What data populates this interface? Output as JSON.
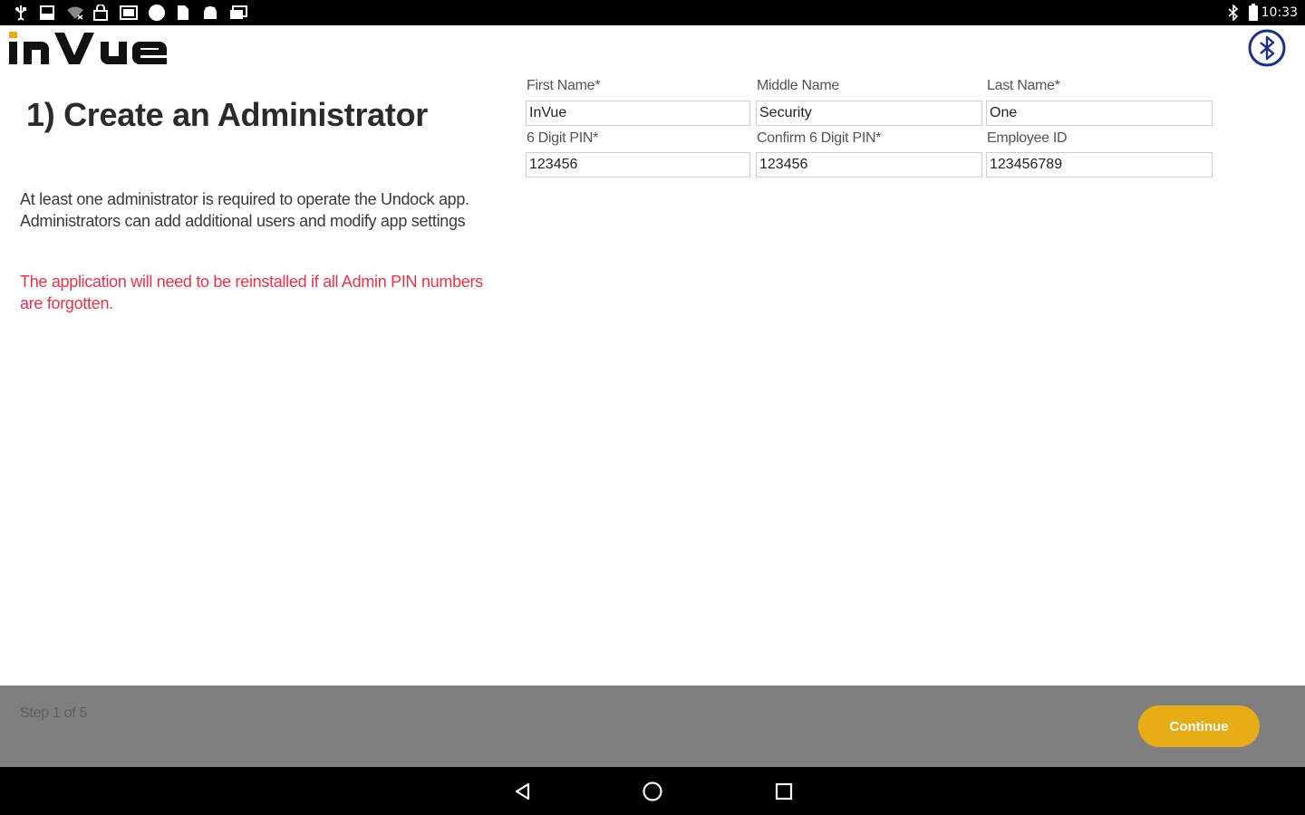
{
  "status_bar": {
    "time": "10:33",
    "left_icons": [
      "usb-icon",
      "download-icon",
      "wifi-off-icon",
      "lock-icon",
      "gallery-icon",
      "circle-icon",
      "sd-card-icon",
      "android-icon",
      "photos-icon"
    ],
    "right_icons": [
      "bluetooth-icon",
      "battery-icon"
    ]
  },
  "header": {
    "logo_text": "InVue",
    "bluetooth_icon": "bluetooth-icon",
    "accent_color": "#1c2f8f"
  },
  "page": {
    "title": "1) Create an Administrator",
    "info": "At least one administrator is required to operate the Undock app. Administrators can add additional users and modify app settings",
    "warning": "The application will need to be reinstalled if all Admin PIN numbers are forgotten.",
    "warning_color": "#e8334a"
  },
  "form": {
    "first_name": {
      "label": "First Name*",
      "value": "InVue"
    },
    "middle_name": {
      "label": "Middle Name",
      "value": "Security"
    },
    "last_name": {
      "label": "Last Name*",
      "value": "One"
    },
    "pin": {
      "label": "6 Digit PIN*",
      "value": "123456"
    },
    "confirm_pin": {
      "label": "Confirm 6 Digit PIN*",
      "value": "123456"
    },
    "employee_id": {
      "label": "Employee ID",
      "value": "123456789"
    }
  },
  "footer": {
    "step_text": "Step 1 of 5",
    "continue_label": "Continue",
    "continue_color": "#e8ac17",
    "bar_color": "#7f7f7f"
  },
  "nav_bar": {
    "icons": [
      "back-icon",
      "home-icon",
      "recents-icon"
    ]
  }
}
